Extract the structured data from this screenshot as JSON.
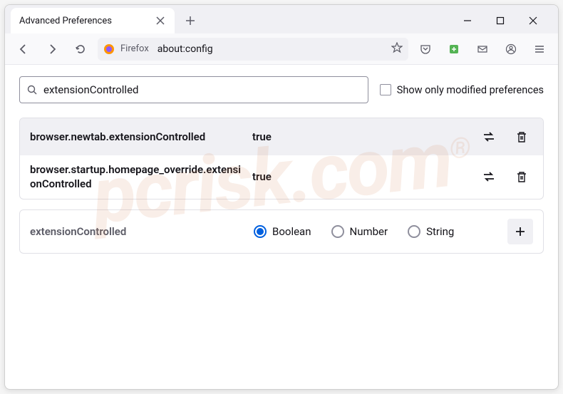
{
  "tab": {
    "title": "Advanced Preferences"
  },
  "address": {
    "label": "Firefox",
    "url": "about:config"
  },
  "search": {
    "value": "extensionControlled",
    "checkbox_label": "Show only modified preferences"
  },
  "prefs": [
    {
      "name": "browser.newtab.extensionControlled",
      "value": "true"
    },
    {
      "name": "browser.startup.homepage_override.extensionControlled",
      "value": "true"
    }
  ],
  "add": {
    "name": "extensionControlled",
    "types": [
      "Boolean",
      "Number",
      "String"
    ],
    "selected": "Boolean"
  },
  "watermark": "pcrisk.com"
}
